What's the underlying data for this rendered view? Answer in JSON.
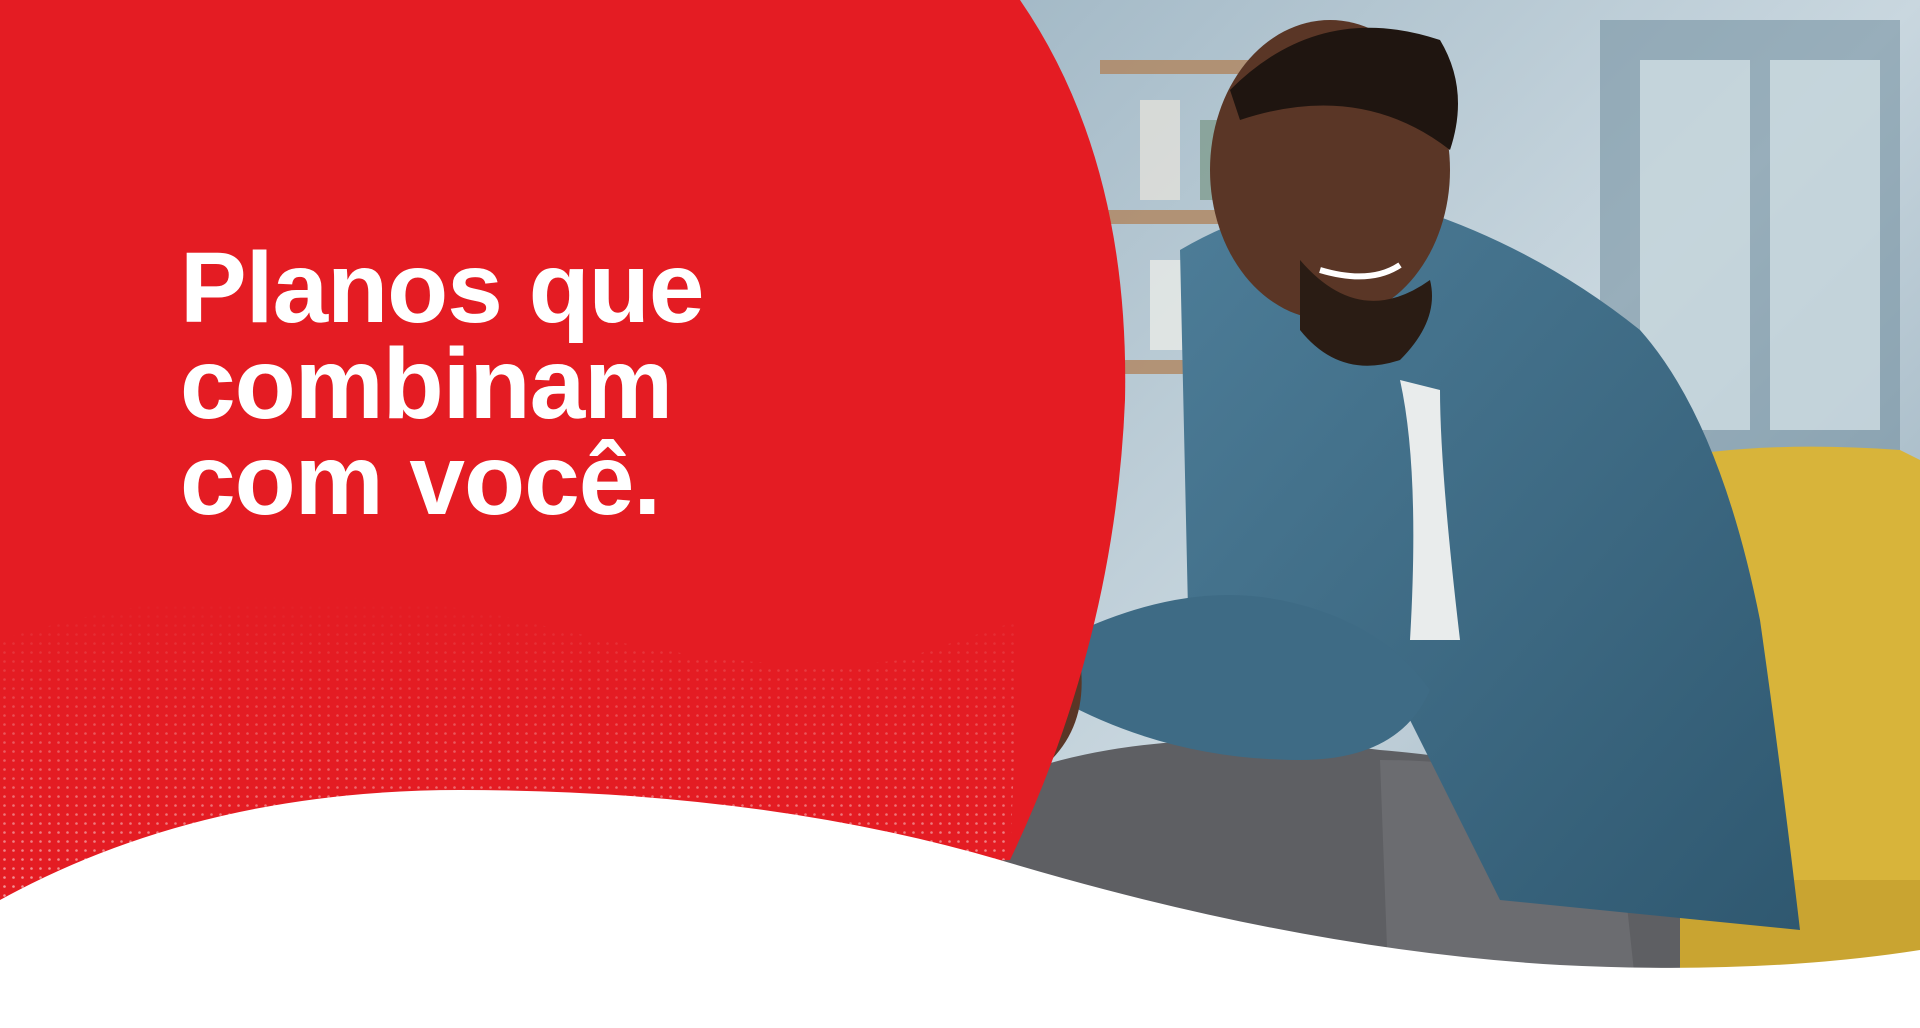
{
  "hero": {
    "headline_lines": [
      "Planos que",
      "combinam",
      "com você."
    ]
  },
  "colors": {
    "brand_red": "#E41C23",
    "white": "#FFFFFF",
    "shirt_blue": "#3C6A86",
    "sofa_yellow": "#D8B43A",
    "pants_gray": "#5E5F63",
    "skin": "#5A3626"
  },
  "icons": {
    "photo": "man-with-smartphone-photo",
    "pattern": "dot-wave-pattern"
  }
}
